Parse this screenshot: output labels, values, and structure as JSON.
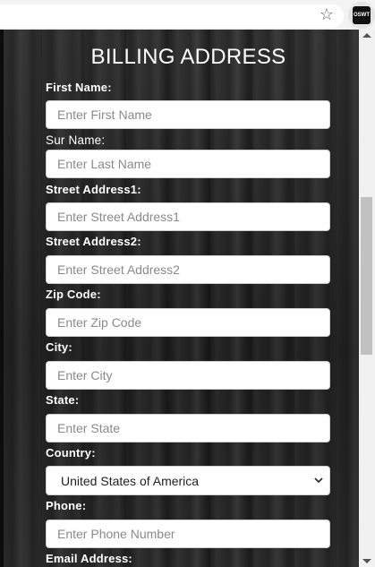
{
  "browser": {
    "bookmark_icon": "star-icon",
    "extension_label": "OSWT"
  },
  "form": {
    "title": "BILLING ADDRESS",
    "fields": [
      {
        "label": "First Name:",
        "placeholder": "Enter First Name"
      },
      {
        "label": "Sur Name:",
        "placeholder": "Enter Last Name"
      },
      {
        "label": "Street Address1:",
        "placeholder": "Enter Street Address1"
      },
      {
        "label": "Street Address2:",
        "placeholder": "Enter Street Address2"
      },
      {
        "label": "Zip Code:",
        "placeholder": "Enter Zip Code"
      },
      {
        "label": "City:",
        "placeholder": "Enter City"
      },
      {
        "label": "State:",
        "placeholder": "Enter State"
      }
    ],
    "country": {
      "label": "Country:",
      "selected": "United States of America"
    },
    "phone": {
      "label": "Phone:",
      "placeholder": "Enter Phone Number"
    },
    "email": {
      "label": "Email Address:"
    }
  }
}
